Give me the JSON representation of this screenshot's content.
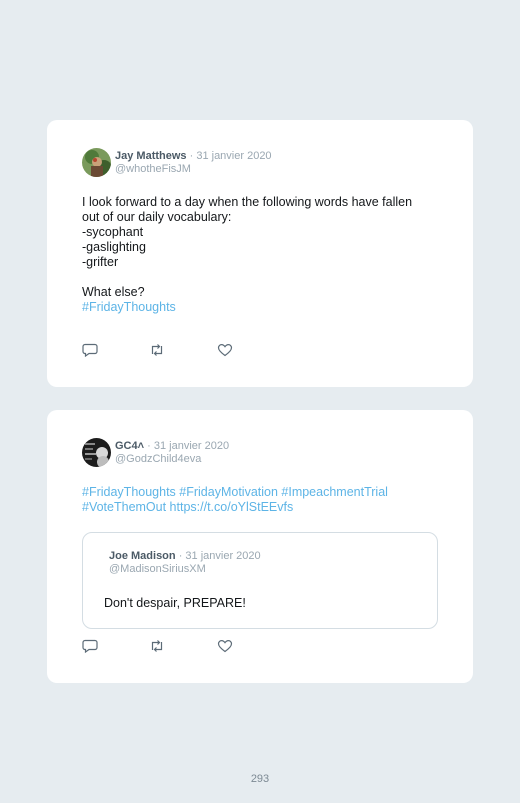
{
  "tweets": [
    {
      "name": "Jay Matthews",
      "separator": "·",
      "date": "31 janvier 2020",
      "handle": "@whotheFisJM",
      "body": "I look forward to a day when the following words have fallen\nout of our daily vocabulary:\n-sycophant\n-gaslighting\n-grifter\n\nWhat else?",
      "hashtag": "#FridayThoughts"
    },
    {
      "name": "GC4˄",
      "separator": "·",
      "date": "31 janvier 2020",
      "handle": "@GodzChild4eva",
      "body_links": "#FridayThoughts #FridayMotivation #ImpeachmentTrial\n#VoteThemOut https://t.co/oYlStEEvfs",
      "quoted": {
        "name": "Joe Madison",
        "separator": "·",
        "date": "31 janvier 2020",
        "handle": "@MadisonSiriusXM",
        "body": "Don't despair, PREPARE!"
      }
    }
  ],
  "icons": [
    "reply-icon",
    "retweet-icon",
    "like-icon"
  ],
  "colors": {
    "background": "#e6ecf0",
    "link": "#5db4e6",
    "name": "#4b5a66",
    "muted": "#9aa7b1"
  },
  "page_number": "293"
}
